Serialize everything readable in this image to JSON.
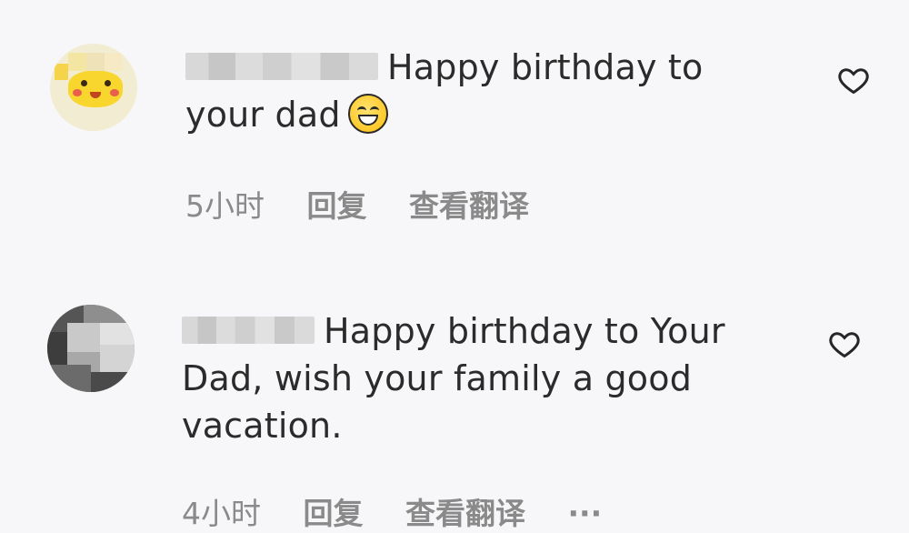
{
  "comments": [
    {
      "text_part1": "Happy birthday to",
      "text_part2": "your dad",
      "emoji": "grinning-face",
      "time": "5小时",
      "reply_label": "回复",
      "translate_label": "查看翻译"
    },
    {
      "text_part1": "Happy birthday to Your",
      "text_part2": "Dad, wish your family a good",
      "text_part3": "vacation.",
      "time": "4小时",
      "reply_label": "回复",
      "translate_label": "查看翻译",
      "more_label": "···"
    }
  ],
  "colors": {
    "background": "#f7f7f9",
    "text": "#2b2b2b",
    "meta_text": "#8a8a8a"
  }
}
